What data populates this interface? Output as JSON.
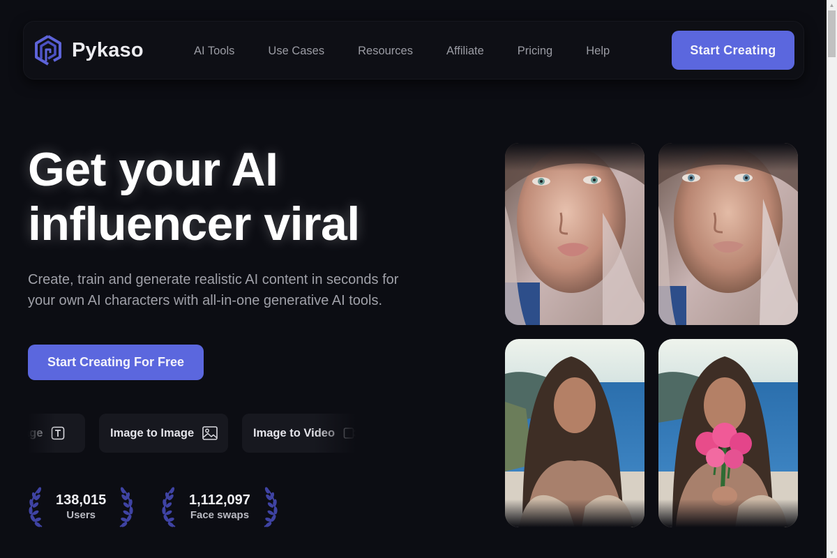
{
  "brand": {
    "name": "Pykaso",
    "accent_color": "#5b67de"
  },
  "nav": {
    "links": [
      "AI Tools",
      "Use Cases",
      "Resources",
      "Affiliate",
      "Pricing",
      "Help"
    ],
    "cta_label": "Start Creating"
  },
  "hero": {
    "title_line1": "Get your AI",
    "title_line2": "influencer viral",
    "subtitle_line1": "Create, train and generate realistic AI content in seconds for",
    "subtitle_line2": "your own AI characters with all-in-one generative AI tools.",
    "cta_label": "Start Creating For Free"
  },
  "tools": [
    {
      "label": "Text to Image",
      "visible_label": "age",
      "icon": "text-box-icon"
    },
    {
      "label": "Image to Image",
      "visible_label": "Image to Image",
      "icon": "image-icon"
    },
    {
      "label": "Image to Video",
      "visible_label": "Image to Video",
      "icon": "video-icon"
    }
  ],
  "stats": [
    {
      "value": "138,015",
      "label": "Users"
    },
    {
      "value": "1,112,097",
      "label": "Face swaps"
    }
  ],
  "gallery": [
    {
      "alt": "AI portrait close-up, blonde woman (original)"
    },
    {
      "alt": "AI portrait close-up, blonde woman (face swapped)"
    },
    {
      "alt": "AI woman on balcony by the sea"
    },
    {
      "alt": "AI woman on balcony holding pink flowers"
    }
  ]
}
